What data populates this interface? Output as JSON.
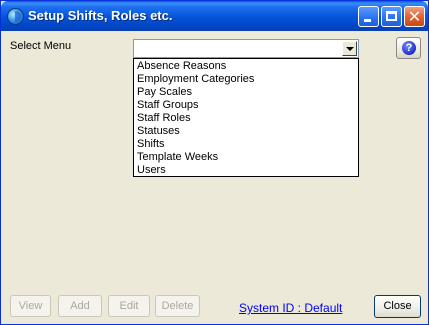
{
  "window": {
    "title": "Setup Shifts, Roles etc.",
    "icon": "globe-app-icon",
    "controls": [
      "minimize-icon",
      "maximize-icon",
      "close-icon"
    ]
  },
  "select_menu": {
    "label": "Select Menu",
    "value": "",
    "options": [
      "Absence Reasons",
      "Employment Categories",
      "Pay Scales",
      "Staff Groups",
      "Staff Roles",
      "Statuses",
      "Shifts",
      "Template Weeks",
      "Users"
    ]
  },
  "help": {
    "glyph": "?"
  },
  "buttons": {
    "view": "View",
    "add": "Add",
    "edit": "Edit",
    "delete": "Delete",
    "close": "Close"
  },
  "system_id": "System ID : Default",
  "colors": {
    "titlebar": "#0453d8",
    "window_bg": "#ece9d8",
    "link": "#0000ff",
    "disabled_text": "#aca899"
  }
}
